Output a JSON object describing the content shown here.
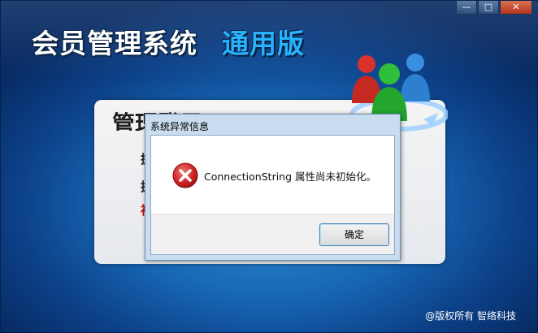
{
  "window": {
    "controls": {
      "minimize": "—",
      "maximize": "□",
      "close": "✕"
    }
  },
  "app": {
    "title": "会员管理系统",
    "edition": "通用版",
    "copyright": "@版权所有 智络科技"
  },
  "login_panel": {
    "title": "管理登录",
    "row_glyphs": [
      "挶",
      "挶",
      "袖"
    ]
  },
  "dialog": {
    "title": "系统异常信息",
    "message": "ConnectionString 属性尚未初始化。",
    "ok_label": "确定",
    "icon": "error-icon"
  },
  "colors": {
    "background": "#1766b4",
    "title_accent": "#27b3ff",
    "error_red": "#d3262b"
  }
}
